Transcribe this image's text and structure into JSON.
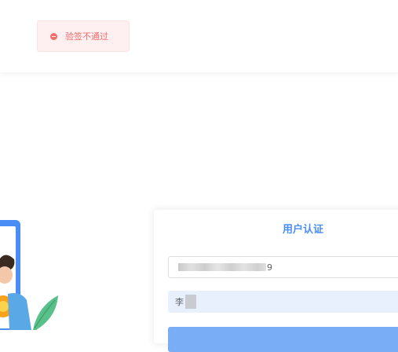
{
  "toast": {
    "icon": "error-circle-icon",
    "message": "验签不通过",
    "color": "#f56c6c",
    "background": "#fef0f0"
  },
  "auth": {
    "title": "用户认证",
    "title_color": "#4a8df5",
    "username_suffix": "9",
    "password_prefix": "李",
    "button_color": "#79aef7"
  }
}
